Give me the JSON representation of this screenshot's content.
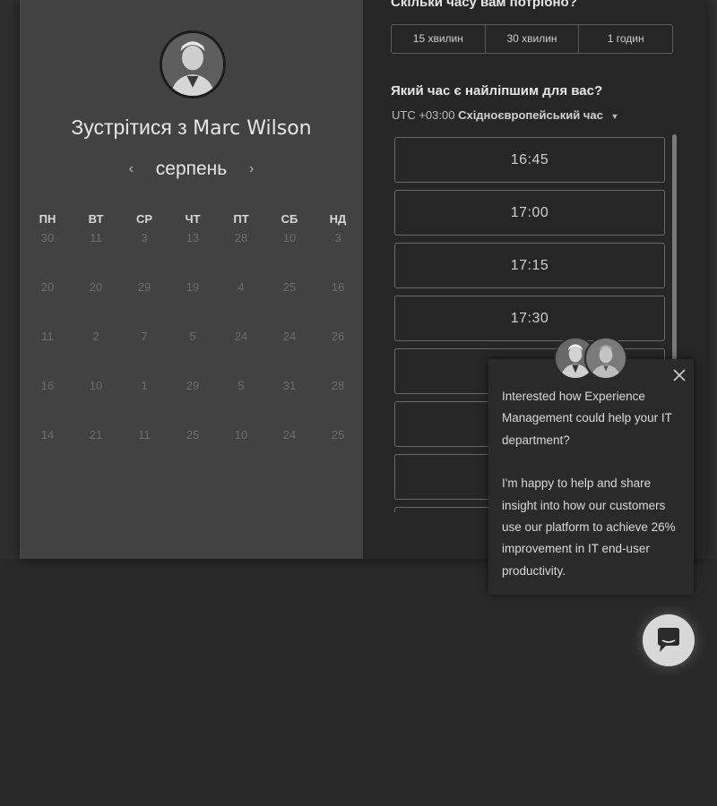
{
  "profile": {
    "meet_prefix": "Зустрітися з",
    "name": "Marc Wilson"
  },
  "calendar": {
    "month": "серпень",
    "prev_icon": "chevron-left-icon",
    "next_icon": "chevron-right-icon",
    "weekdays": [
      "ПН",
      "ВТ",
      "СР",
      "ЧТ",
      "ПТ",
      "СБ",
      "НД"
    ],
    "weeks": [
      [
        "30",
        "11",
        "3",
        "13",
        "28",
        "10",
        "3"
      ],
      [
        "20",
        "20",
        "29",
        "19",
        "4",
        "25",
        "16"
      ],
      [
        "11",
        "2",
        "7",
        "5",
        "24",
        "24",
        "26"
      ],
      [
        "16",
        "10",
        "1",
        "29",
        "5",
        "31",
        "28"
      ],
      [
        "14",
        "21",
        "11",
        "25",
        "10",
        "24",
        "25"
      ]
    ]
  },
  "duration": {
    "question": "Скільки часу вам потрібно?",
    "options": [
      "15 хвилин",
      "30 хвилин",
      "1 годин"
    ]
  },
  "time": {
    "question": "Який час є найліпшим для вас?",
    "tz_offset": "UTC +03:00",
    "tz_name": "Східноєвропейський час",
    "slots": [
      "16:45",
      "17:00",
      "17:15",
      "17:30",
      "",
      "",
      "",
      ""
    ]
  },
  "chat_popup": {
    "close_icon": "close-icon",
    "message_1": "Interested how Experience Management could help your IT department?",
    "message_2": "I'm happy to help and share insight into how our customers use our platform to achieve 26% improvement in IT end-user productivity."
  },
  "chat_launcher": {
    "icon": "chat-bubble-icon"
  },
  "colors": {
    "background": "#292929",
    "left_panel": "#424242",
    "right_panel": "#262626",
    "launcher": "#d8d8d8"
  }
}
